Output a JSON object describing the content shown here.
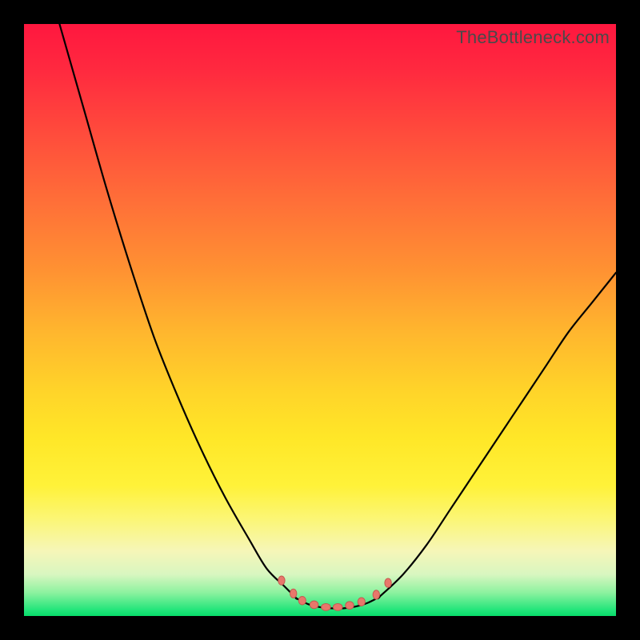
{
  "watermark": "TheBottleneck.com",
  "colors": {
    "frame": "#000000",
    "curve": "#000000",
    "marker_fill": "#e8776b",
    "marker_stroke": "#c55a50",
    "gradient_top": "#ff173f",
    "gradient_bottom": "#08dc6a"
  },
  "chart_data": {
    "type": "line",
    "title": "",
    "xlabel": "",
    "ylabel": "",
    "xlim": [
      0,
      100
    ],
    "ylim": [
      0,
      100
    ],
    "grid": false,
    "legend": false,
    "note": "Axes have no visible tick labels; x/y expressed as 0–100 percent of plot extent, y=0 at bottom.",
    "series": [
      {
        "name": "left-branch",
        "x": [
          6,
          10,
          14,
          18,
          22,
          26,
          30,
          34,
          38,
          41,
          44,
          46
        ],
        "y": [
          100,
          86,
          72,
          59,
          47,
          37,
          28,
          20,
          13,
          8,
          5,
          3
        ]
      },
      {
        "name": "valley-floor",
        "x": [
          46,
          48,
          50,
          52,
          54,
          56,
          58,
          60
        ],
        "y": [
          3,
          2,
          1.5,
          1.3,
          1.3,
          1.6,
          2.2,
          3.2
        ]
      },
      {
        "name": "right-branch",
        "x": [
          60,
          64,
          68,
          72,
          76,
          80,
          84,
          88,
          92,
          96,
          100
        ],
        "y": [
          3.2,
          7,
          12,
          18,
          24,
          30,
          36,
          42,
          48,
          53,
          58
        ]
      }
    ],
    "markers": {
      "name": "valley-markers",
      "x": [
        43.5,
        45.5,
        47,
        49,
        51,
        53,
        55,
        57,
        59.5,
        61.5
      ],
      "y": [
        6.0,
        3.8,
        2.6,
        1.9,
        1.5,
        1.5,
        1.8,
        2.4,
        3.6,
        5.6
      ],
      "rx": [
        4.2,
        4.2,
        4.6,
        5.2,
        5.8,
        5.8,
        5.2,
        4.6,
        4.2,
        4.2
      ],
      "ry": [
        5.6,
        5.6,
        5.2,
        4.8,
        4.4,
        4.4,
        4.8,
        5.2,
        5.6,
        5.6
      ]
    }
  }
}
